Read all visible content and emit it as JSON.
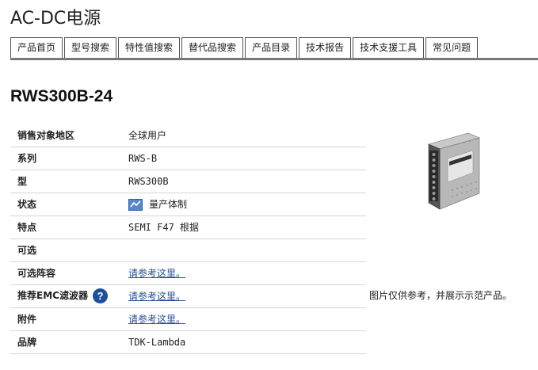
{
  "page": {
    "title": "AC-DC电源"
  },
  "tabs": [
    {
      "label": "产品首页"
    },
    {
      "label": "型号搜索"
    },
    {
      "label": "特性值搜索"
    },
    {
      "label": "替代品搜索"
    },
    {
      "label": "产品目录"
    },
    {
      "label": "技术报告"
    },
    {
      "label": "技术支援工具"
    },
    {
      "label": "常见问题"
    }
  ],
  "product": {
    "model": "RWS300B-24",
    "image_caption": "图片仅供参考，并展示示范产品。"
  },
  "specs": [
    {
      "label": "销售对象地区",
      "value": "全球用户"
    },
    {
      "label": "系列",
      "value": "RWS-B"
    },
    {
      "label": "型",
      "value": "RWS300B"
    },
    {
      "label": "状态",
      "value": "量产体制",
      "icon": "mass-production-status-icon"
    },
    {
      "label": "特点",
      "value": "SEMI F47 根据"
    },
    {
      "label": "可选",
      "value": ""
    },
    {
      "label": "可选阵容",
      "value": "请参考这里。"
    },
    {
      "label": "推荐EMC滤波器",
      "value": "请参考这里。",
      "help_icon_text": "?"
    },
    {
      "label": "附件",
      "value": "请参考这里。"
    },
    {
      "label": "品牌",
      "value": "TDK-Lambda"
    }
  ],
  "colors": {
    "link": "#2a4f8f",
    "help_icon": "#1f4f9a",
    "tab_underline": "#777777"
  }
}
